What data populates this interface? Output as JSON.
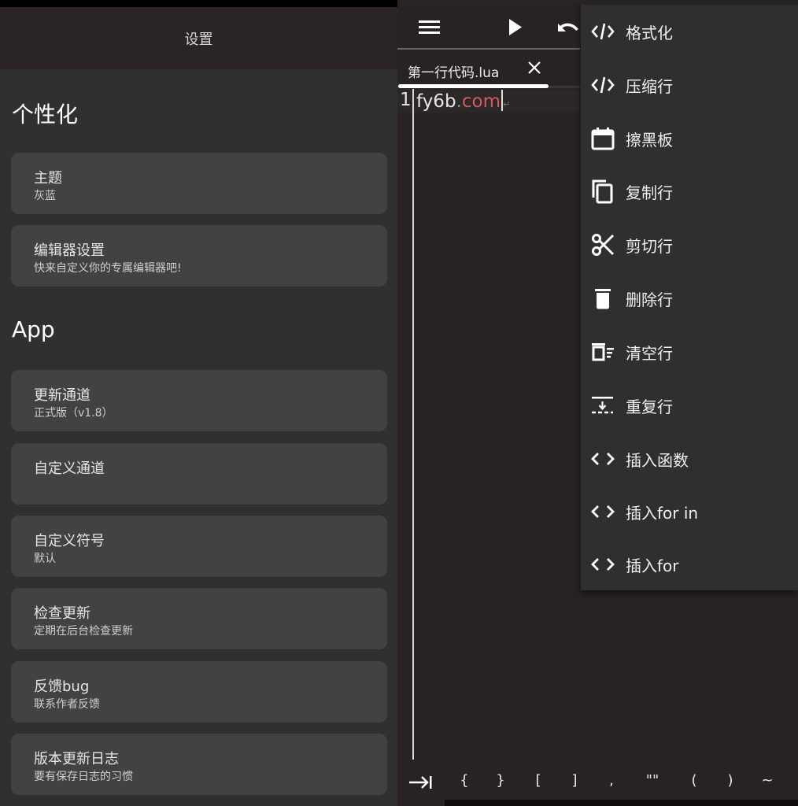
{
  "settings": {
    "header_title": "设置",
    "sections": [
      {
        "title": "个性化",
        "items": [
          {
            "title": "主题",
            "subtitle": "灰蓝"
          },
          {
            "title": "编辑器设置",
            "subtitle": "快来自定义你的专属编辑器吧!"
          }
        ]
      },
      {
        "title": "App",
        "items": [
          {
            "title": "更新通道",
            "subtitle": "正式版（v1.8）"
          },
          {
            "title": "自定义通道",
            "subtitle": ""
          },
          {
            "title": "自定义符号",
            "subtitle": "默认"
          },
          {
            "title": "检查更新",
            "subtitle": "定期在后台检查更新"
          },
          {
            "title": "反馈bug",
            "subtitle": "联系作者反馈"
          },
          {
            "title": "版本更新日志",
            "subtitle": "要有保存日志的习惯"
          }
        ]
      }
    ]
  },
  "editor": {
    "toolbar": {
      "menu_icon": "hamburger-menu-icon",
      "run_icon": "play-icon",
      "undo_icon": "undo-icon"
    },
    "tab": {
      "label": "第一行代码.lua",
      "close_icon": "close-icon"
    },
    "lines": [
      {
        "number": "1",
        "text_a": "fy6b",
        "text_dot": ".",
        "text_b": "com",
        "eol_mark": "↵"
      }
    ],
    "symbols": [
      "{",
      "}",
      "[",
      "]",
      ",",
      "\"\"",
      "(",
      ")",
      "~"
    ],
    "tab_key_icon": "tab-key-icon",
    "colors": {
      "keyword": "#d15a5f",
      "background": "#282222"
    }
  },
  "menu": {
    "items": [
      {
        "label": "格式化",
        "icon": "code-icon"
      },
      {
        "label": "压缩行",
        "icon": "code-icon"
      },
      {
        "label": "擦黑板",
        "icon": "calendar-icon"
      },
      {
        "label": "复制行",
        "icon": "copy-icon"
      },
      {
        "label": "剪切行",
        "icon": "scissors-icon"
      },
      {
        "label": "删除行",
        "icon": "trash-icon"
      },
      {
        "label": "清空行",
        "icon": "clear-line-icon"
      },
      {
        "label": "重复行",
        "icon": "duplicate-line-icon"
      },
      {
        "label": "插入函数",
        "icon": "angle-brackets-icon"
      },
      {
        "label": "插入for in",
        "icon": "angle-brackets-icon"
      },
      {
        "label": "插入for",
        "icon": "angle-brackets-icon"
      }
    ]
  }
}
